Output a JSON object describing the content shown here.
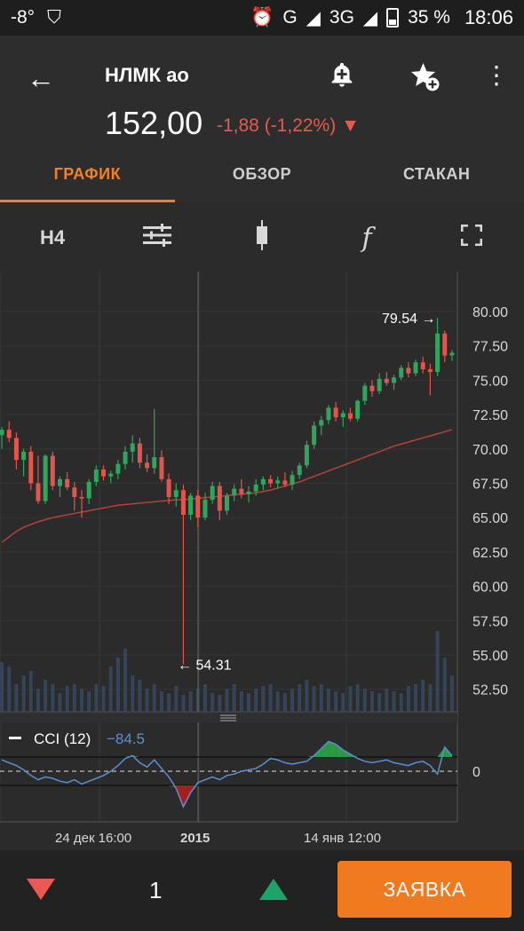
{
  "statusbar": {
    "temp": "-8°",
    "network": "G",
    "network2": "3G",
    "battery": "35 %",
    "time": "18:06"
  },
  "header": {
    "ticker": "НЛМК ао",
    "price": "152,00",
    "change": "-1,88 (-1,22%)",
    "change_arrow": "▼"
  },
  "tabs": [
    {
      "label": "ГРАФИК",
      "active": true
    },
    {
      "label": "ОБЗОР",
      "active": false
    },
    {
      "label": "СТАКАН",
      "active": false
    }
  ],
  "toolbar": {
    "timeframe": "H4",
    "function_glyph": "f"
  },
  "chart_data": {
    "type": "candlestick",
    "ylim": [
      50,
      82
    ],
    "yticks": [
      "80.00",
      "77.50",
      "75.00",
      "72.50",
      "70.00",
      "67.50",
      "65.00",
      "62.50",
      "60.00",
      "57.50",
      "55.00",
      "52.50"
    ],
    "xticks": [
      "24 дек 16:00",
      "2015",
      "14 янв 12:00"
    ],
    "annotations": [
      {
        "label": "79.54 →",
        "value": 79.54
      },
      {
        "label": "← 54.31",
        "value": 54.31
      }
    ],
    "candles": [
      [
        71.0,
        71.6,
        70.0,
        71.4
      ],
      [
        71.4,
        72.0,
        70.5,
        70.8
      ],
      [
        70.8,
        71.2,
        68.5,
        69.2
      ],
      [
        69.2,
        70.0,
        68.0,
        69.8
      ],
      [
        69.8,
        70.2,
        67.0,
        67.5
      ],
      [
        67.5,
        69.5,
        66.0,
        66.2
      ],
      [
        66.2,
        69.6,
        66.0,
        69.5
      ],
      [
        69.5,
        69.8,
        67.0,
        67.3
      ],
      [
        67.3,
        68.0,
        66.5,
        67.8
      ],
      [
        67.8,
        68.3,
        67.0,
        67.2
      ],
      [
        67.2,
        67.6,
        65.5,
        66.5
      ],
      [
        66.5,
        67.0,
        65.0,
        66.4
      ],
      [
        66.4,
        67.8,
        66.0,
        67.6
      ],
      [
        67.6,
        68.8,
        67.3,
        68.5
      ],
      [
        68.5,
        68.8,
        67.7,
        68.0
      ],
      [
        68.0,
        68.4,
        67.5,
        68.2
      ],
      [
        68.2,
        69.2,
        67.8,
        68.9
      ],
      [
        68.9,
        70.2,
        68.5,
        69.8
      ],
      [
        69.8,
        71.0,
        69.0,
        70.4
      ],
      [
        70.4,
        70.8,
        68.6,
        69.0
      ],
      [
        69.0,
        69.6,
        68.3,
        68.6
      ],
      [
        68.6,
        72.9,
        68.2,
        69.4
      ],
      [
        69.4,
        69.9,
        67.6,
        67.8
      ],
      [
        67.8,
        68.2,
        66.0,
        66.5
      ],
      [
        66.5,
        67.5,
        65.8,
        67.0
      ],
      [
        67.0,
        67.4,
        54.31,
        65.2
      ],
      [
        65.2,
        66.8,
        64.8,
        66.6
      ],
      [
        66.6,
        67.0,
        64.3,
        65.0
      ],
      [
        65.0,
        66.8,
        64.8,
        66.3
      ],
      [
        66.3,
        67.6,
        66.0,
        67.3
      ],
      [
        67.3,
        67.6,
        64.8,
        65.5
      ],
      [
        65.5,
        66.8,
        65.2,
        66.6
      ],
      [
        66.6,
        67.4,
        66.2,
        67.1
      ],
      [
        67.1,
        67.8,
        66.4,
        66.7
      ],
      [
        66.7,
        67.3,
        66.1,
        66.9
      ],
      [
        66.9,
        67.8,
        66.6,
        67.4
      ],
      [
        67.4,
        68.0,
        67.0,
        67.8
      ],
      [
        67.8,
        68.1,
        67.2,
        67.5
      ],
      [
        67.5,
        68.0,
        67.1,
        67.7
      ],
      [
        67.7,
        68.3,
        67.2,
        67.4
      ],
      [
        67.4,
        68.4,
        67.0,
        68.1
      ],
      [
        68.1,
        69.0,
        67.8,
        68.8
      ],
      [
        68.8,
        70.6,
        68.6,
        70.3
      ],
      [
        70.3,
        72.0,
        70.0,
        71.7
      ],
      [
        71.7,
        72.4,
        71.0,
        72.1
      ],
      [
        72.1,
        73.2,
        71.8,
        73.0
      ],
      [
        73.0,
        73.4,
        72.0,
        72.3
      ],
      [
        72.3,
        72.8,
        71.6,
        72.6
      ],
      [
        72.6,
        73.0,
        72.0,
        72.2
      ],
      [
        72.2,
        73.6,
        72.0,
        73.5
      ],
      [
        73.5,
        74.8,
        73.2,
        74.6
      ],
      [
        74.6,
        75.0,
        73.8,
        74.2
      ],
      [
        74.2,
        75.5,
        74.0,
        75.1
      ],
      [
        75.1,
        75.6,
        74.6,
        74.8
      ],
      [
        74.8,
        75.4,
        74.3,
        75.2
      ],
      [
        75.2,
        76.1,
        75.0,
        75.9
      ],
      [
        75.9,
        76.3,
        75.2,
        75.5
      ],
      [
        75.5,
        76.5,
        75.3,
        76.3
      ],
      [
        76.3,
        76.7,
        75.5,
        75.8
      ],
      [
        75.8,
        76.2,
        73.9,
        75.6
      ],
      [
        75.6,
        79.54,
        75.3,
        78.4
      ],
      [
        78.4,
        78.6,
        76.3,
        76.8
      ],
      [
        76.8,
        77.2,
        76.4,
        77.0
      ]
    ],
    "ma": [
      63.2,
      63.6,
      64.0,
      64.3,
      64.5,
      64.7,
      64.85,
      65.0,
      65.1,
      65.2,
      65.3,
      65.4,
      65.5,
      65.6,
      65.7,
      65.8,
      65.9,
      65.95,
      66.0,
      66.05,
      66.1,
      66.15,
      66.2,
      66.25,
      66.3,
      66.3,
      66.35,
      66.4,
      66.45,
      66.5,
      66.55,
      66.6,
      66.65,
      66.7,
      66.75,
      66.8,
      66.9,
      67.0,
      67.15,
      67.3,
      67.45,
      67.6,
      67.8,
      68.0,
      68.2,
      68.4,
      68.6,
      68.8,
      69.0,
      69.2,
      69.4,
      69.6,
      69.8,
      70.0,
      70.2,
      70.35,
      70.5,
      70.65,
      70.8,
      70.95,
      71.1,
      71.25,
      71.4
    ],
    "volume": [
      0.55,
      0.5,
      0.3,
      0.4,
      0.45,
      0.25,
      0.35,
      0.3,
      0.2,
      0.28,
      0.3,
      0.25,
      0.22,
      0.3,
      0.28,
      0.5,
      0.6,
      0.7,
      0.4,
      0.35,
      0.25,
      0.3,
      0.22,
      0.2,
      0.28,
      0.18,
      0.22,
      0.25,
      0.3,
      0.2,
      0.18,
      0.25,
      0.3,
      0.22,
      0.2,
      0.25,
      0.28,
      0.3,
      0.22,
      0.2,
      0.25,
      0.3,
      0.35,
      0.28,
      0.3,
      0.25,
      0.22,
      0.2,
      0.28,
      0.3,
      0.25,
      0.22,
      0.2,
      0.25,
      0.22,
      0.2,
      0.28,
      0.3,
      0.35,
      0.3,
      0.9,
      0.6,
      0.4
    ],
    "indicator": {
      "name": "CCI (12)",
      "value": "−84.5",
      "zero_label": "0",
      "values": [
        80,
        60,
        40,
        10,
        -30,
        -60,
        -40,
        -50,
        -70,
        -80,
        -60,
        -90,
        -70,
        -50,
        -30,
        0,
        40,
        90,
        110,
        60,
        30,
        80,
        20,
        -40,
        -120,
        -250,
        -150,
        -80,
        -60,
        -40,
        -60,
        -30,
        -20,
        0,
        10,
        20,
        50,
        90,
        80,
        60,
        50,
        60,
        70,
        110,
        160,
        210,
        190,
        150,
        120,
        90,
        70,
        60,
        70,
        80,
        60,
        50,
        40,
        60,
        70,
        40,
        -20,
        170,
        110
      ]
    }
  },
  "bottom": {
    "qty": "1",
    "order_label": "ЗАЯВКА"
  }
}
